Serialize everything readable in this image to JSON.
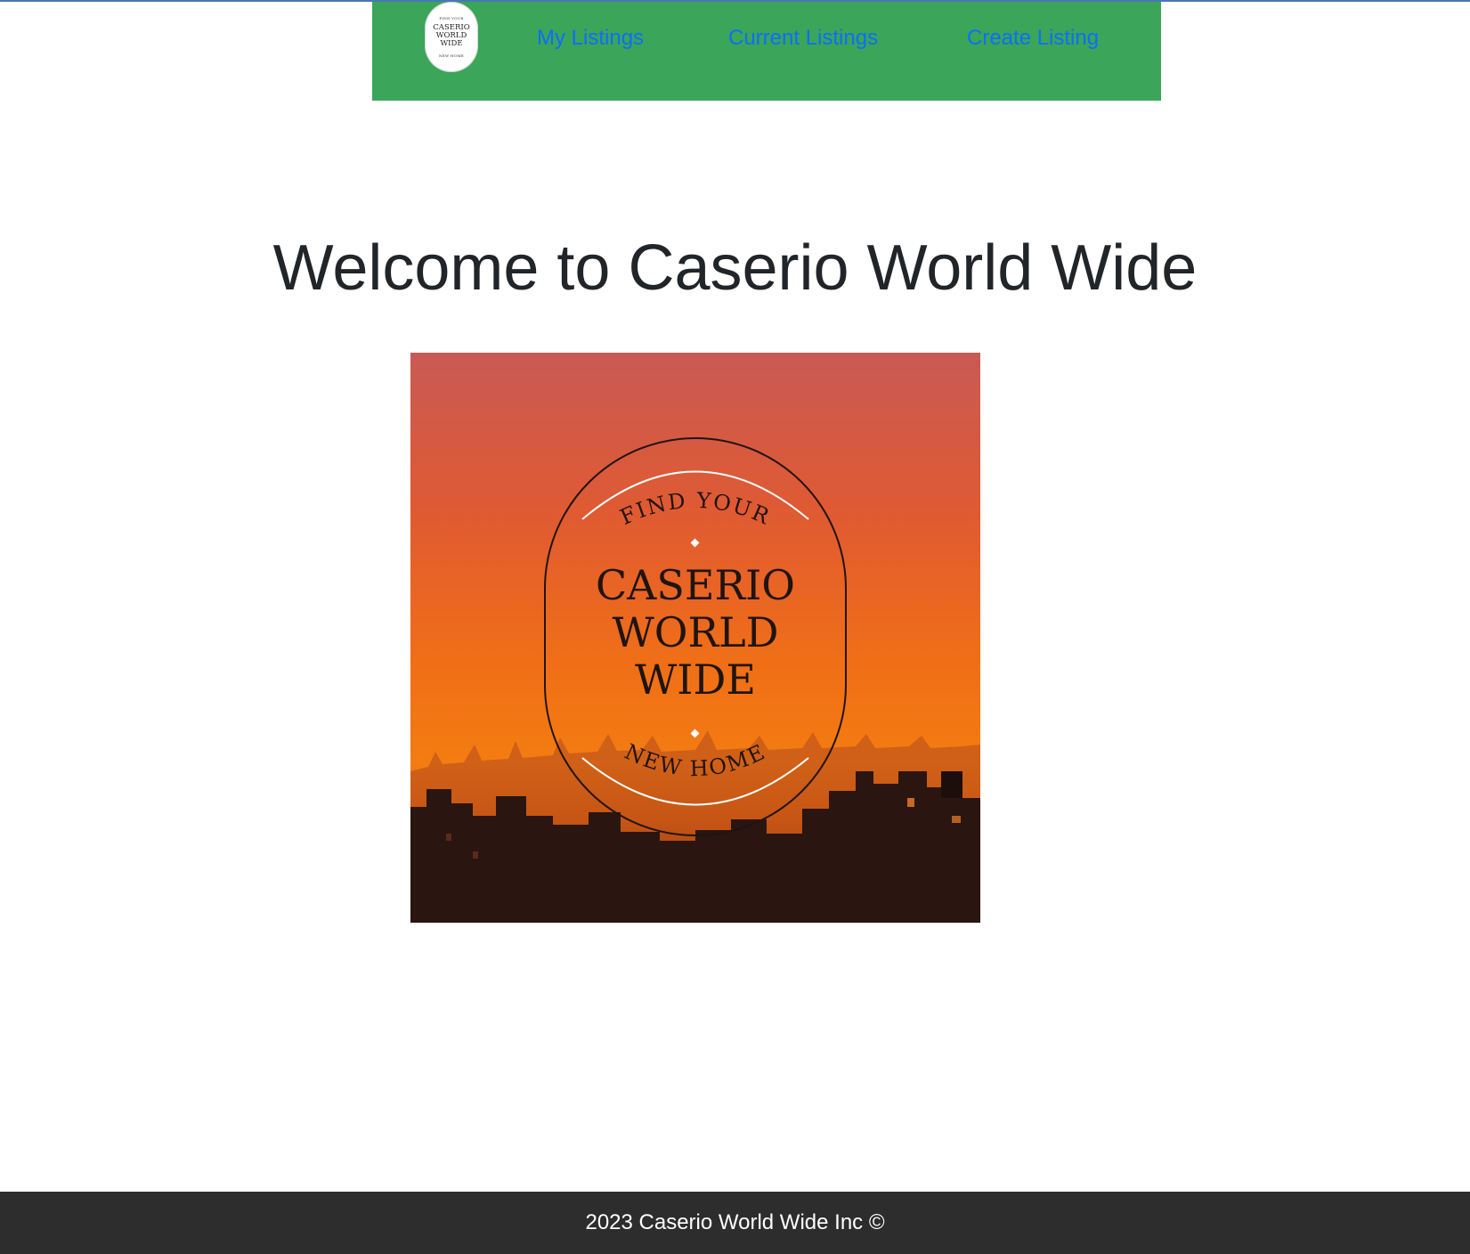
{
  "navbar": {
    "logo": {
      "top_text": "FIND YOUR",
      "brand_lines": [
        "CASERIO",
        "WORLD",
        "WIDE"
      ],
      "bottom_text": "NEW HOME"
    },
    "links": [
      {
        "label": "My Listings"
      },
      {
        "label": "Current Listings"
      },
      {
        "label": "Create Listing"
      }
    ]
  },
  "hero": {
    "title": "Welcome to Caserio World Wide",
    "image": {
      "top_text": "FIND YOUR",
      "brand_lines": [
        "CASERIO",
        "WORLD",
        "WIDE"
      ],
      "bottom_text": "NEW HOME"
    }
  },
  "footer": {
    "text": "2023 Caserio World Wide Inc ©"
  },
  "colors": {
    "navbar_bg": "#3ba55a",
    "link": "#0d6efd",
    "footer_bg": "#2d2d2d",
    "title": "#212529"
  }
}
